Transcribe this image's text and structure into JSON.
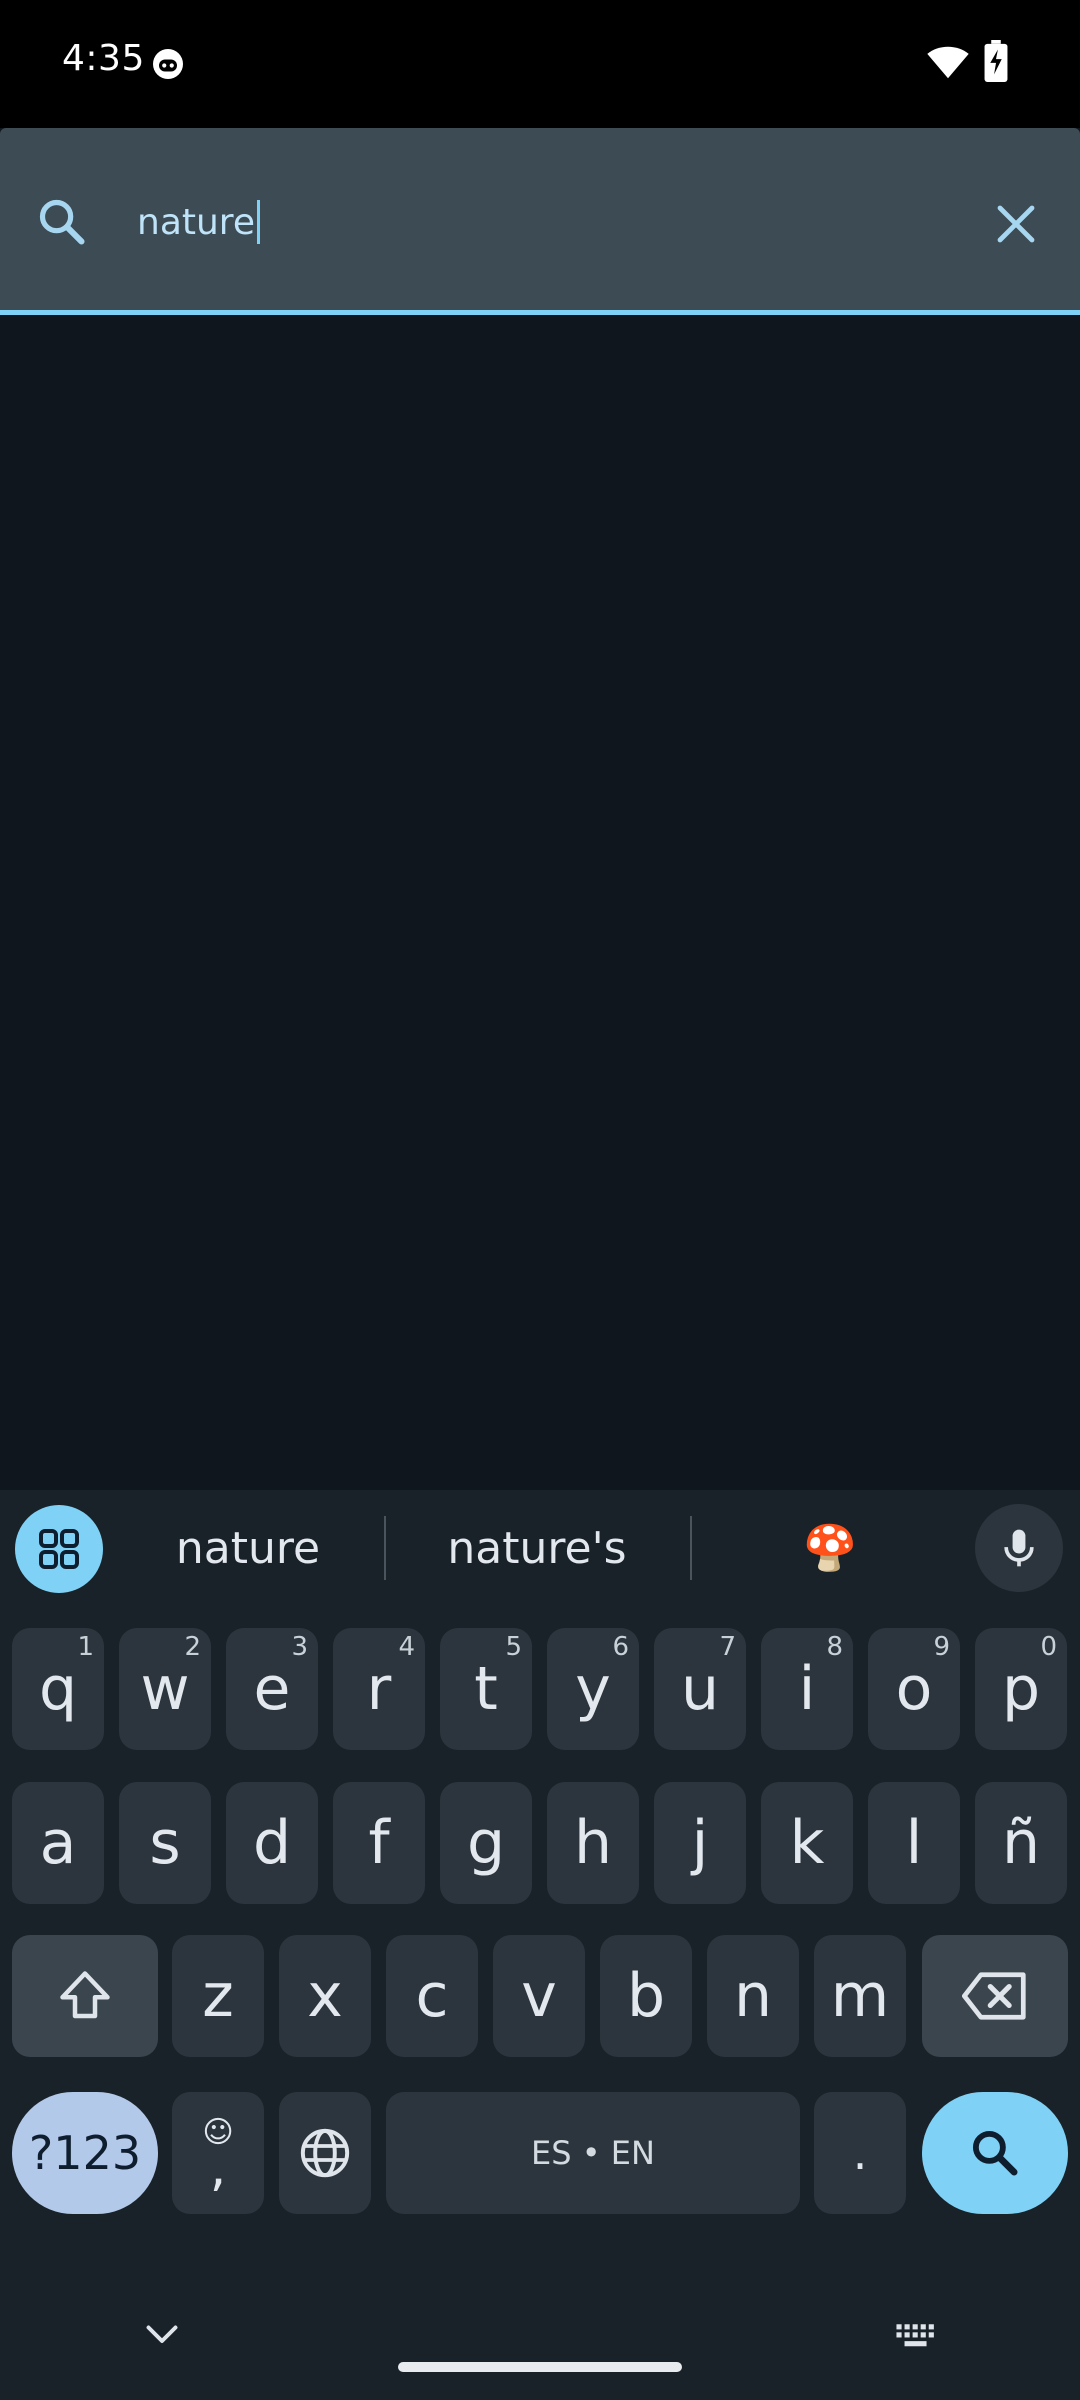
{
  "status_bar": {
    "time": "4:35"
  },
  "search": {
    "value": "nature"
  },
  "keyboard": {
    "suggestions": [
      "nature",
      "nature's",
      "🍄"
    ],
    "rows": [
      [
        {
          "k": "q",
          "h": "1"
        },
        {
          "k": "w",
          "h": "2"
        },
        {
          "k": "e",
          "h": "3"
        },
        {
          "k": "r",
          "h": "4"
        },
        {
          "k": "t",
          "h": "5"
        },
        {
          "k": "y",
          "h": "6"
        },
        {
          "k": "u",
          "h": "7"
        },
        {
          "k": "i",
          "h": "8"
        },
        {
          "k": "o",
          "h": "9"
        },
        {
          "k": "p",
          "h": "0"
        }
      ],
      [
        {
          "k": "a"
        },
        {
          "k": "s"
        },
        {
          "k": "d"
        },
        {
          "k": "f"
        },
        {
          "k": "g"
        },
        {
          "k": "h"
        },
        {
          "k": "j"
        },
        {
          "k": "k"
        },
        {
          "k": "l"
        },
        {
          "k": "ñ"
        }
      ],
      [
        {
          "k": "z"
        },
        {
          "k": "x"
        },
        {
          "k": "c"
        },
        {
          "k": "v"
        },
        {
          "k": "b"
        },
        {
          "k": "n"
        },
        {
          "k": "m"
        }
      ]
    ],
    "numbers_label": "?123",
    "comma_label": ",",
    "emoji_glyph": "☺",
    "space_label": "ES • EN",
    "period_label": "."
  },
  "colors": {
    "accent": "#7fd2f6",
    "search_bar": "#3d4b54",
    "background": "#0f161d",
    "key": "#2c353d"
  },
  "icons": {
    "search": "search-icon",
    "clear": "close-icon",
    "apps": "apps-grid-icon",
    "mic": "microphone-icon",
    "shift": "shift-icon",
    "backspace": "backspace-icon",
    "globe": "globe-icon",
    "keyboard_search": "search-icon",
    "nav_down": "chevron-down-icon",
    "keyboard_switch": "keyboard-icon"
  }
}
